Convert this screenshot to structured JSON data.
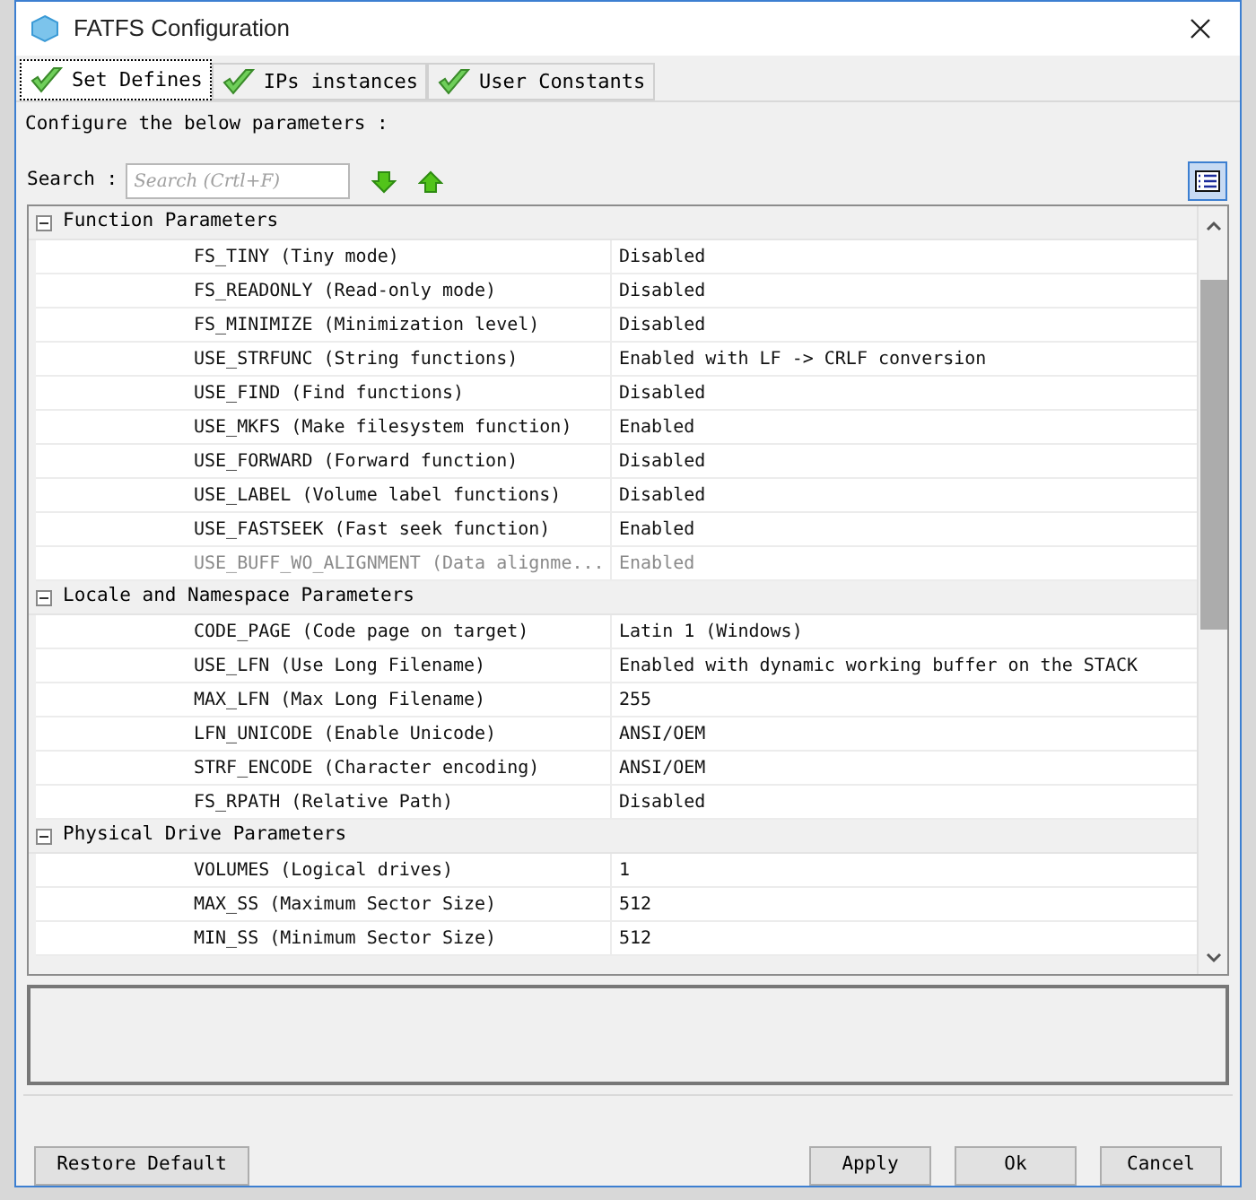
{
  "window": {
    "title": "FATFS Configuration"
  },
  "tabs": [
    {
      "label": "Set Defines",
      "selected": true
    },
    {
      "label": "IPs instances",
      "selected": false
    },
    {
      "label": "User Constants",
      "selected": false
    }
  ],
  "instruction": "Configure the below parameters :",
  "search": {
    "label": "Search :",
    "placeholder": "Search (Crtl+F)"
  },
  "groups": [
    {
      "title": "Function Parameters",
      "expanded": true,
      "rows": [
        {
          "name": "FS_TINY (Tiny mode)",
          "value": "Disabled",
          "disabled": false
        },
        {
          "name": "FS_READONLY (Read-only mode)",
          "value": "Disabled",
          "disabled": false
        },
        {
          "name": "FS_MINIMIZE (Minimization level)",
          "value": "Disabled",
          "disabled": false
        },
        {
          "name": "USE_STRFUNC (String functions)",
          "value": "Enabled with LF -> CRLF conversion",
          "disabled": false
        },
        {
          "name": "USE_FIND (Find functions)",
          "value": "Disabled",
          "disabled": false
        },
        {
          "name": "USE_MKFS (Make filesystem function)",
          "value": "Enabled",
          "disabled": false
        },
        {
          "name": "USE_FORWARD (Forward function)",
          "value": "Disabled",
          "disabled": false
        },
        {
          "name": "USE_LABEL (Volume label functions)",
          "value": "Disabled",
          "disabled": false
        },
        {
          "name": "USE_FASTSEEK (Fast seek function)",
          "value": "Enabled",
          "disabled": false
        },
        {
          "name": "USE_BUFF_WO_ALIGNMENT (Data alignme...",
          "value": "Enabled",
          "disabled": true
        }
      ]
    },
    {
      "title": "Locale and Namespace Parameters",
      "expanded": true,
      "rows": [
        {
          "name": "CODE_PAGE (Code page on target)",
          "value": "Latin 1 (Windows)",
          "disabled": false
        },
        {
          "name": "USE_LFN (Use Long Filename)",
          "value": "Enabled with dynamic working buffer on the STACK",
          "disabled": false
        },
        {
          "name": "MAX_LFN (Max Long Filename)",
          "value": "255",
          "disabled": false
        },
        {
          "name": "LFN_UNICODE (Enable Unicode)",
          "value": "ANSI/OEM",
          "disabled": false
        },
        {
          "name": "STRF_ENCODE (Character encoding)",
          "value": "ANSI/OEM",
          "disabled": false
        },
        {
          "name": "FS_RPATH (Relative Path)",
          "value": "Disabled",
          "disabled": false
        }
      ]
    },
    {
      "title": "Physical Drive Parameters",
      "expanded": true,
      "rows": [
        {
          "name": "VOLUMES (Logical drives)",
          "value": "1",
          "disabled": false
        },
        {
          "name": "MAX_SS (Maximum Sector Size)",
          "value": "512",
          "disabled": false
        },
        {
          "name": "MIN_SS (Minimum Sector Size)",
          "value": "512",
          "disabled": false
        }
      ]
    }
  ],
  "buttons": {
    "restore": "Restore Default",
    "apply": "Apply",
    "ok": "Ok",
    "cancel": "Cancel"
  }
}
